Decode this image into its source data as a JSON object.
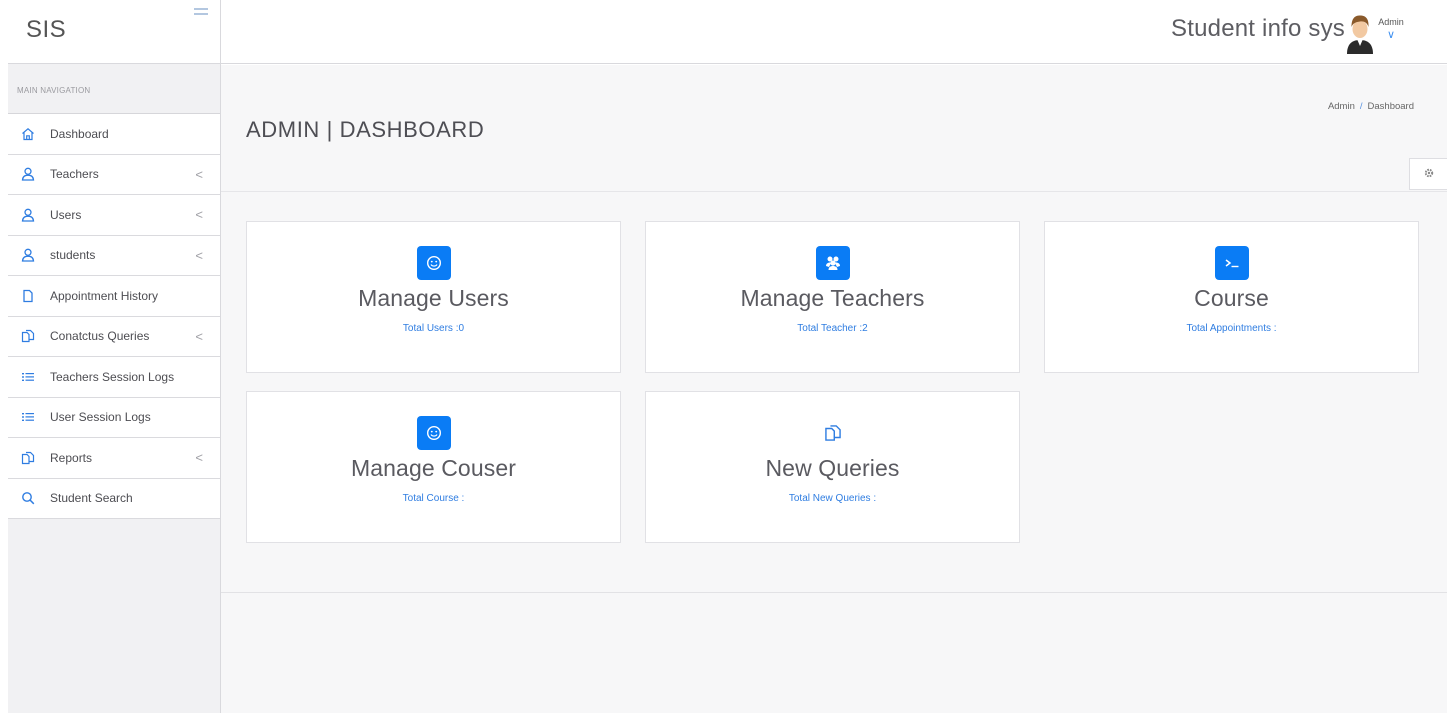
{
  "brand": {
    "name": "SIS"
  },
  "header": {
    "app_title": "Student info sys",
    "user_name": "Admin",
    "caret": "∨"
  },
  "sidebar": {
    "section_label": "MAIN NAVIGATION",
    "items": [
      {
        "label": "Dashboard",
        "icon": "home-icon",
        "has_submenu": false
      },
      {
        "label": "Teachers",
        "icon": "user-icon",
        "has_submenu": true
      },
      {
        "label": "Users",
        "icon": "user-icon",
        "has_submenu": true
      },
      {
        "label": "students",
        "icon": "user-icon",
        "has_submenu": true
      },
      {
        "label": "Appointment History",
        "icon": "file-icon",
        "has_submenu": false
      },
      {
        "label": "Conatctus Queries",
        "icon": "files-icon",
        "has_submenu": true
      },
      {
        "label": "Teachers Session Logs",
        "icon": "list-icon",
        "has_submenu": false
      },
      {
        "label": "User Session Logs",
        "icon": "list-icon",
        "has_submenu": false
      },
      {
        "label": "Reports",
        "icon": "files-icon",
        "has_submenu": true
      },
      {
        "label": "Student Search",
        "icon": "search-icon",
        "has_submenu": false
      }
    ],
    "chevron": "<"
  },
  "page": {
    "title": "ADMIN | DASHBOARD",
    "breadcrumb": {
      "root": "Admin",
      "separator": "/",
      "current": "Dashboard"
    }
  },
  "cards": [
    {
      "title": "Manage Users",
      "link": "Total Users :0",
      "icon": "smile-icon"
    },
    {
      "title": "Manage Teachers",
      "link": "Total Teacher :2",
      "icon": "users-group-icon"
    },
    {
      "title": "Course",
      "link": "Total Appointments :",
      "icon": "terminal-icon"
    },
    {
      "title": "Manage Couser",
      "link": "Total Course :",
      "icon": "smile-icon"
    },
    {
      "title": "New Queries",
      "link": "Total New Queries :",
      "icon": "files-icon"
    }
  ],
  "colors": {
    "accent": "#0a7cf5",
    "link": "#2f7de1",
    "sidebar_bg": "#f1f1f3"
  }
}
